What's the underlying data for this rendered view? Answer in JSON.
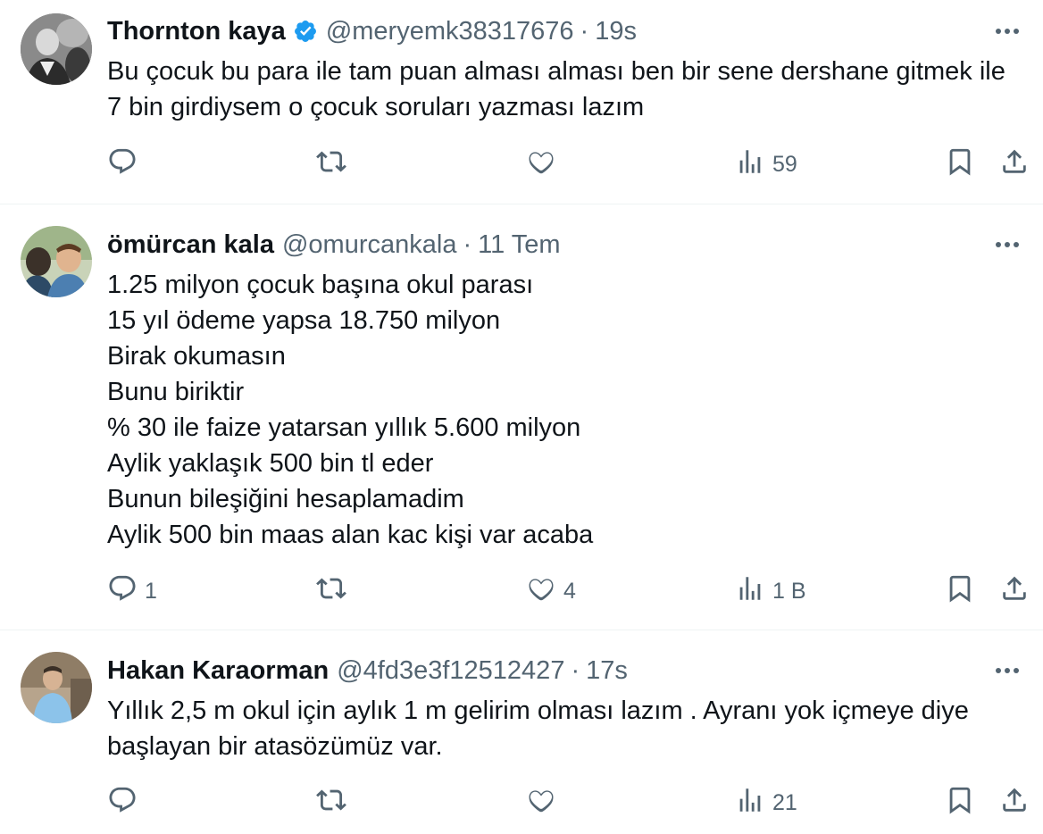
{
  "tweets": [
    {
      "author_name": "Thornton kaya",
      "verified": true,
      "handle": "@meryemk38317676",
      "separator": "·",
      "time": "19s",
      "text": "Bu çocuk bu para ile tam puan alması alması ben bir sene dershane gitmek ile 7 bin girdiysem o çocuk soruları yazması lazım",
      "replies": "",
      "retweets": "",
      "likes": "",
      "views": "59"
    },
    {
      "author_name": "ömürcan kala",
      "verified": false,
      "handle": "@omurcankala",
      "separator": "·",
      "time": "11 Tem",
      "text": "1.25 milyon çocuk başına okul parası\n15 yıl ödeme yapsa 18.750 milyon\nBirak okumasın\nBunu biriktir\n% 30 ile faize yatarsan yıllık 5.600 milyon\nAylik yaklaşık 500 bin tl eder\nBunun bileşiğini hesaplamadim\nAylik 500 bin maas alan kac kişi var acaba",
      "replies": "1",
      "retweets": "",
      "likes": "4",
      "views": "1 B"
    },
    {
      "author_name": "Hakan Karaorman",
      "verified": false,
      "handle": "@4fd3e3f12512427",
      "separator": "·",
      "time": "17s",
      "text": "Yıllık 2,5 m okul için aylık 1 m gelirim olması lazım . Ayranı yok içmeye diye başlayan bir atasözümüz var.",
      "replies": "",
      "retweets": "",
      "likes": "",
      "views": "21"
    }
  ],
  "colors": {
    "text_primary": "#0f1419",
    "text_secondary": "#536471",
    "verified_blue": "#1d9bf0",
    "divider": "#eff3f4"
  },
  "icons": [
    "reply-icon",
    "retweet-icon",
    "like-icon",
    "views-icon",
    "bookmark-icon",
    "share-icon",
    "more-icon",
    "verified-badge-icon"
  ]
}
